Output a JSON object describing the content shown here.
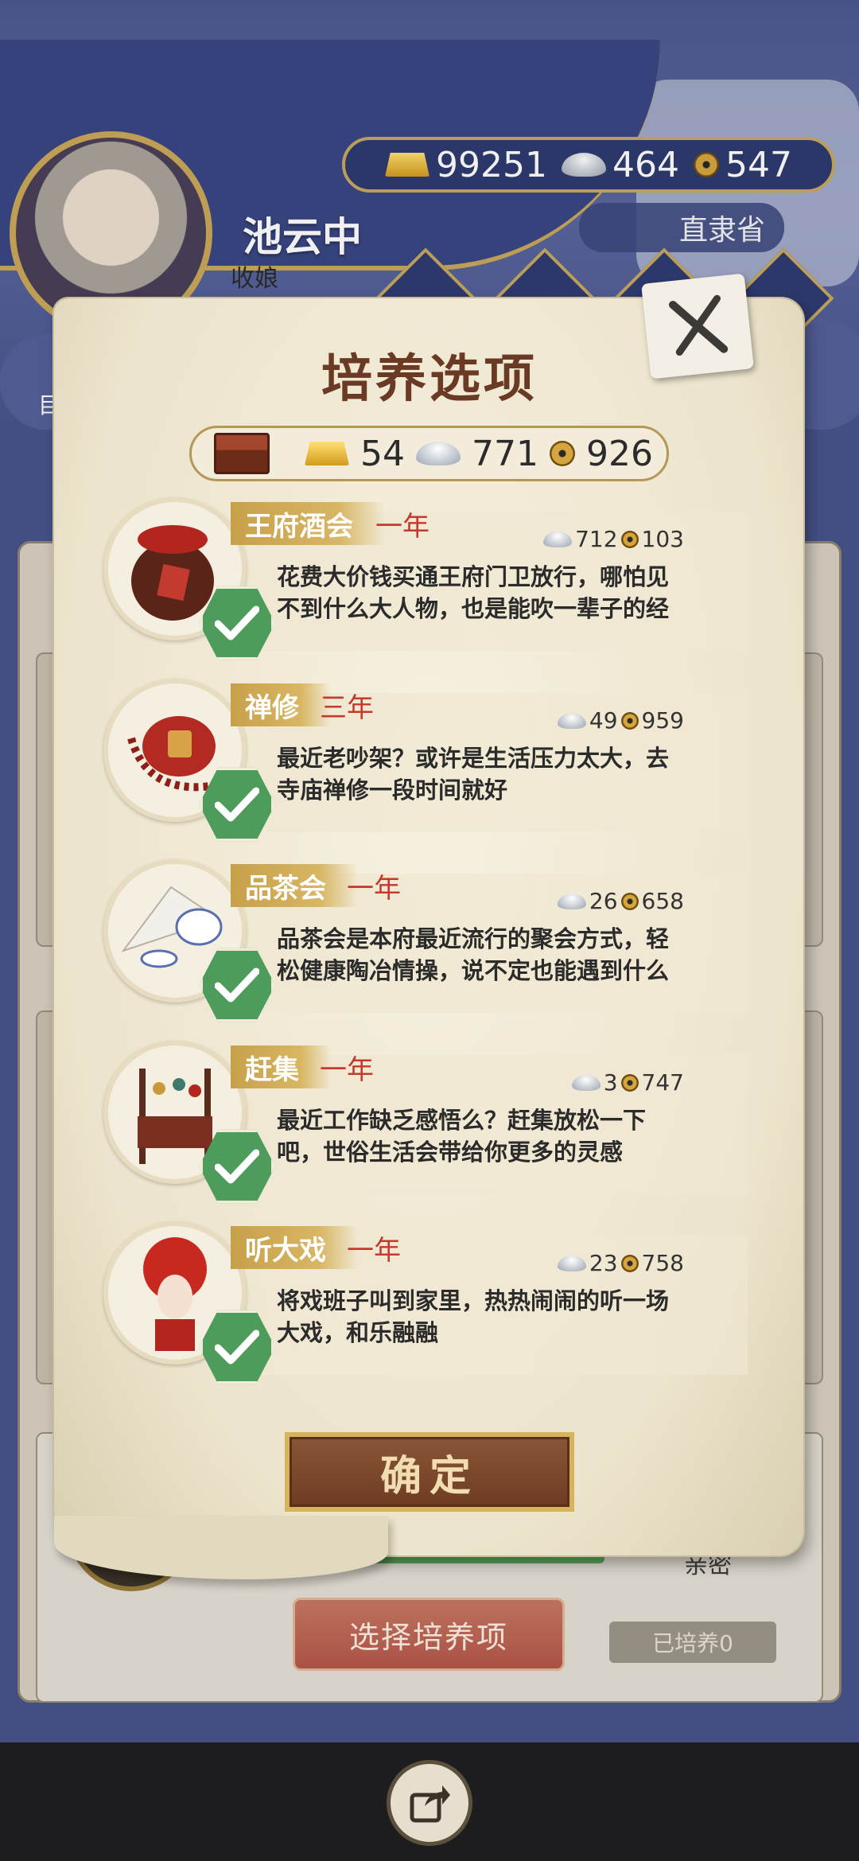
{
  "header": {
    "gold": "99251",
    "silver": "464",
    "coin": "547",
    "character_name": "池云中",
    "character_title": "收娘",
    "province": "直隶省",
    "side_text": "目"
  },
  "background": {
    "select_button": "选择培养项",
    "trained_label": "已培养0",
    "secret_label": "亲密"
  },
  "modal": {
    "title": "培养选项",
    "resources": {
      "gold": "54",
      "silver": "771",
      "coin": "926"
    },
    "items": [
      {
        "name": "王府酒会",
        "duration": "一年",
        "silver": "712",
        "coin": "103",
        "desc": "花费大价钱买通王府门卫放行，哪怕见不到什么大人物，也是能吹一辈子的经",
        "icon": "wine-jar-icon"
      },
      {
        "name": "禅修",
        "duration": "三年",
        "silver": "49",
        "coin": "959",
        "desc": "最近老吵架？或许是生活压力太大，去寺庙禅修一段时间就好",
        "icon": "prayer-beads-icon"
      },
      {
        "name": "品茶会",
        "duration": "一年",
        "silver": "26",
        "coin": "658",
        "desc": "品茶会是本府最近流行的聚会方式，轻松健康陶冶情操，说不定也能遇到什么",
        "icon": "teapot-icon"
      },
      {
        "name": "赶集",
        "duration": "一年",
        "silver": "3",
        "coin": "747",
        "desc": "最近工作缺乏感悟么？赶集放松一下吧，世俗生活会带给你更多的灵感",
        "icon": "market-stall-icon"
      },
      {
        "name": "听大戏",
        "duration": "一年",
        "silver": "23",
        "coin": "758",
        "desc": "将戏班子叫到家里，热热闹闹的听一场大戏，和乐融融",
        "icon": "opera-mask-icon"
      }
    ],
    "confirm_label": "确定"
  }
}
